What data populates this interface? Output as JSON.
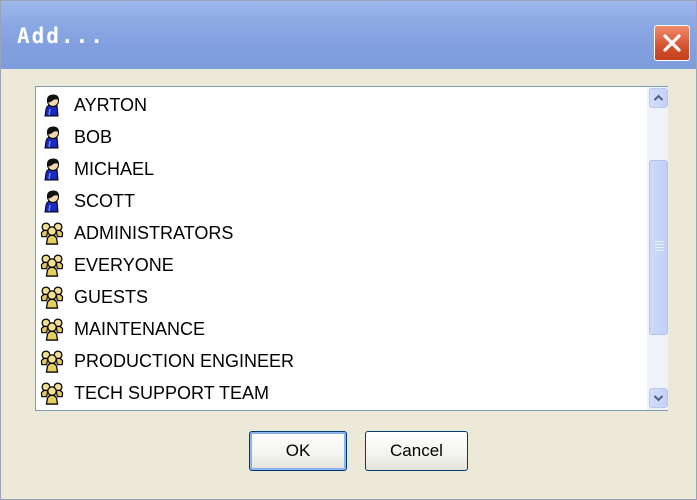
{
  "window": {
    "title": "Add..."
  },
  "list": {
    "items": [
      {
        "label": "AYRTON",
        "icon": "user-icon"
      },
      {
        "label": "BOB",
        "icon": "user-icon"
      },
      {
        "label": "MICHAEL",
        "icon": "user-icon"
      },
      {
        "label": "SCOTT",
        "icon": "user-icon"
      },
      {
        "label": "ADMINISTRATORS",
        "icon": "group-icon"
      },
      {
        "label": "EVERYONE",
        "icon": "group-icon"
      },
      {
        "label": "GUESTS",
        "icon": "group-icon"
      },
      {
        "label": "MAINTENANCE",
        "icon": "group-icon"
      },
      {
        "label": "PRODUCTION ENGINEER",
        "icon": "group-icon"
      },
      {
        "label": "TECH SUPPORT TEAM",
        "icon": "group-icon"
      }
    ]
  },
  "buttons": {
    "ok": "OK",
    "cancel": "Cancel"
  },
  "colors": {
    "titlebar": "#819fdf",
    "close": "#d5532f",
    "dialog_bg": "#ece9d8"
  }
}
